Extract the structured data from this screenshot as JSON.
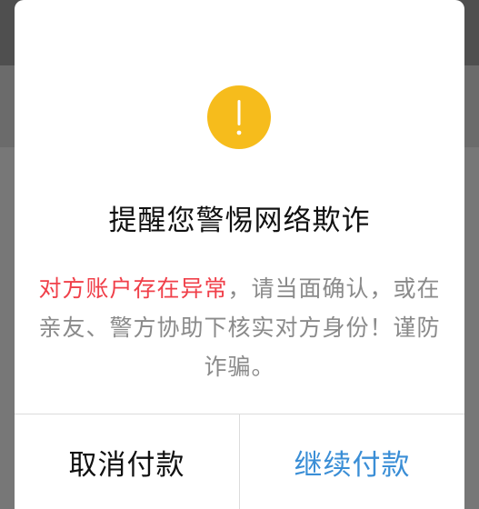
{
  "dialog": {
    "icon": "exclamation-icon",
    "icon_color": "#f6bc1c",
    "title": "提醒您警惕网络欺诈",
    "message_warning": "对方账户存在异常",
    "message_body": "，请当面确认，或在亲友、警方协助下核实对方身份！谨防诈骗。",
    "warning_color": "#f0404a",
    "cancel_label": "取消付款",
    "continue_label": "继续付款",
    "continue_color": "#3a8ed6"
  }
}
